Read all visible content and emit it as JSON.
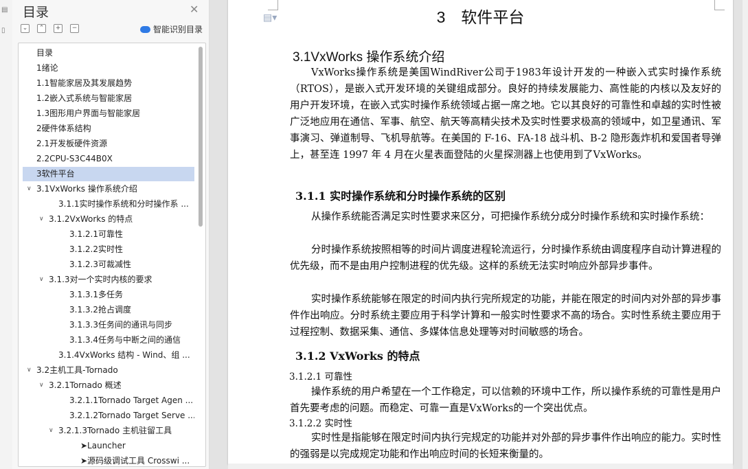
{
  "toc_panel": {
    "title": "目录",
    "smart_button": "智能识别目录",
    "items": [
      {
        "label": "目录",
        "level": 0,
        "toggle": false
      },
      {
        "label": "1绪论",
        "level": 0,
        "toggle": false
      },
      {
        "label": "1.1智能家居及其发展趋势",
        "level": 0,
        "toggle": false
      },
      {
        "label": "1.2嵌入式系统与智能家居",
        "level": 0,
        "toggle": false
      },
      {
        "label": "1.3图形用户界面与智能家居",
        "level": 0,
        "toggle": false
      },
      {
        "label": "2硬件体系结构",
        "level": 0,
        "toggle": false
      },
      {
        "label": "2.1开发板硬件资源",
        "level": 0,
        "toggle": false
      },
      {
        "label": "2.2CPU-S3C44B0X",
        "level": 0,
        "toggle": false
      },
      {
        "label": "3软件平台",
        "level": 0,
        "toggle": false,
        "selected": true
      },
      {
        "label": "3.1VxWorks 操作系统介绍",
        "level": 0,
        "toggle": true
      },
      {
        "label": "3.1.1实时操作系统和分时操作系 ...",
        "level": 2,
        "toggle": false
      },
      {
        "label": "3.1.2VxWorks 的特点",
        "level": 1,
        "toggle": true
      },
      {
        "label": "3.1.2.1可靠性",
        "level": 3,
        "toggle": false
      },
      {
        "label": "3.1.2.2实时性",
        "level": 3,
        "toggle": false
      },
      {
        "label": "3.1.2.3可裁减性",
        "level": 3,
        "toggle": false
      },
      {
        "label": "3.1.3对一个实时内核的要求",
        "level": 1,
        "toggle": true
      },
      {
        "label": "3.1.3.1多任务",
        "level": 3,
        "toggle": false
      },
      {
        "label": "3.1.3.2抢占调度",
        "level": 3,
        "toggle": false
      },
      {
        "label": "3.1.3.3任务间的通讯与同步",
        "level": 3,
        "toggle": false
      },
      {
        "label": "3.1.3.4任务与中断之间的通信",
        "level": 3,
        "toggle": false
      },
      {
        "label": "3.1.4VxWorks 结构 - Wind、组 ...",
        "level": 2,
        "toggle": false
      },
      {
        "label": "3.2主机工具-Tornado",
        "level": 0,
        "toggle": true
      },
      {
        "label": "3.2.1Tornado  概述",
        "level": 1,
        "toggle": true
      },
      {
        "label": "3.2.1.1Tornado Target Agen ...",
        "level": 3,
        "toggle": false
      },
      {
        "label": "3.2.1.2Tornado Target Serve ...",
        "level": 3,
        "toggle": false
      },
      {
        "label": "3.2.1.3Tornado 主机驻留工具",
        "level": 2,
        "toggle": true
      },
      {
        "label": "➤Launcher",
        "level": 4,
        "toggle": false
      },
      {
        "label": "➤源码级调试工具 Crosswi ...",
        "level": 4,
        "toggle": false
      }
    ]
  },
  "document": {
    "chapter_title": "3　软件平台",
    "section_title": "3.1VxWorks 操作系统介绍",
    "intro_para": "VxWorks操作系统是美国WindRiver公司于1983年设计开发的一种嵌入式实时操作系统（RTOS），是嵌入式开发环境的关键组成部分。良好的持续发展能力、高性能的内核以及友好的用户开发环境，在嵌入式实时操作系统领域占据一席之地。它以其良好的可靠性和卓越的实时性被广泛地应用在通信、军事、航空、航天等高精尖技术及实时性要求极高的领域中，如卫星通讯、军事演习、弹道制导、飞机导航等。在美国的 F-16、FA-18 战斗机、B-2 隐形轰炸机和爱国者导弹上，甚至连 1997 年 4 月在火星表面登陆的火星探测器上也使用到了VxWorks。",
    "sub1_title": "3.1.1  实时操作系统和分时操作系统的区别",
    "sub1_para1": "从操作系统能否满足实时性要求来区分，可把操作系统分成分时操作系统和实时操作系统：",
    "sub1_para2": "分时操作系统按照相等的时间片调度进程轮流运行，分时操作系统由调度程序自动计算进程的优先级，而不是由用户控制进程的优先级。这样的系统无法实时响应外部异步事件。",
    "sub1_para3": "实时操作系统能够在限定的时间内执行完所规定的功能，并能在限定的时间内对外部的异步事件作出响应。分时系统主要应用于科学计算和一般实时性要求不高的场合。实时性系统主要应用于过程控制、数据采集、通信、多媒体信息处理等对时间敏感的场合。",
    "sub2_title": "3.1.2  VxWorks 的特点",
    "sub21_title": "3.1.2.1  可靠性",
    "sub21_para": "操作系统的用户希望在一个工作稳定，可以信赖的环境中工作，所以操作系统的可靠性是用户首先要考虑的问题。而稳定、可靠一直是VxWorks的一个突出优点。",
    "sub22_title": "3.1.2.2  实时性",
    "sub22_para": "实时性是指能够在限定时间内执行完规定的功能并对外部的异步事件作出响应的能力。实时性的强弱是以完成规定功能和作出响应时间的长短来衡量的。"
  }
}
